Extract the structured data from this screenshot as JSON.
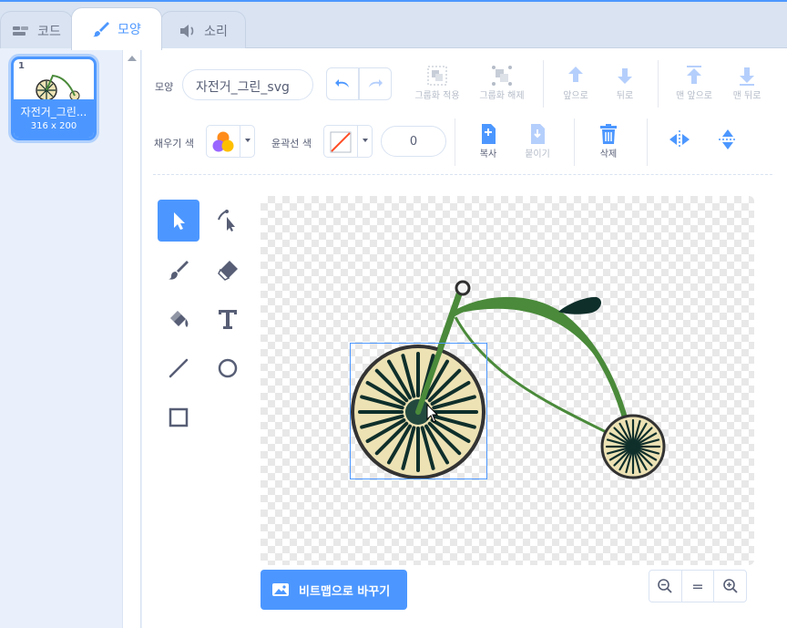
{
  "tabs": {
    "code": "코드",
    "costumes": "모양",
    "sounds": "소리"
  },
  "costume_list": [
    {
      "number": "1",
      "name": "자전거_그린...",
      "size": "316 x 200"
    }
  ],
  "toolbar": {
    "costume_label": "모양",
    "costume_name": "자전거_그린_svg",
    "group": "그룹화 적용",
    "ungroup": "그룹화 해제",
    "forward": "앞으로",
    "backward": "뒤로",
    "front": "맨 앞으로",
    "back": "맨 뒤로",
    "fill_label": "채우기 색",
    "outline_label": "윤곽선 색",
    "outline_width": "0",
    "copy": "복사",
    "paste": "붙이기",
    "delete": "삭제"
  },
  "bottom": {
    "convert_button": "비트맵으로 바꾸기",
    "zoom_out": "−",
    "zoom_reset": "=",
    "zoom_in": "+"
  },
  "colors": {
    "accent": "#4c97ff",
    "frame_green": "#4a8a3a",
    "wheel_fill": "#ede2b4",
    "spoke": "#0f2f2b",
    "tire": "#2f2f2f"
  }
}
